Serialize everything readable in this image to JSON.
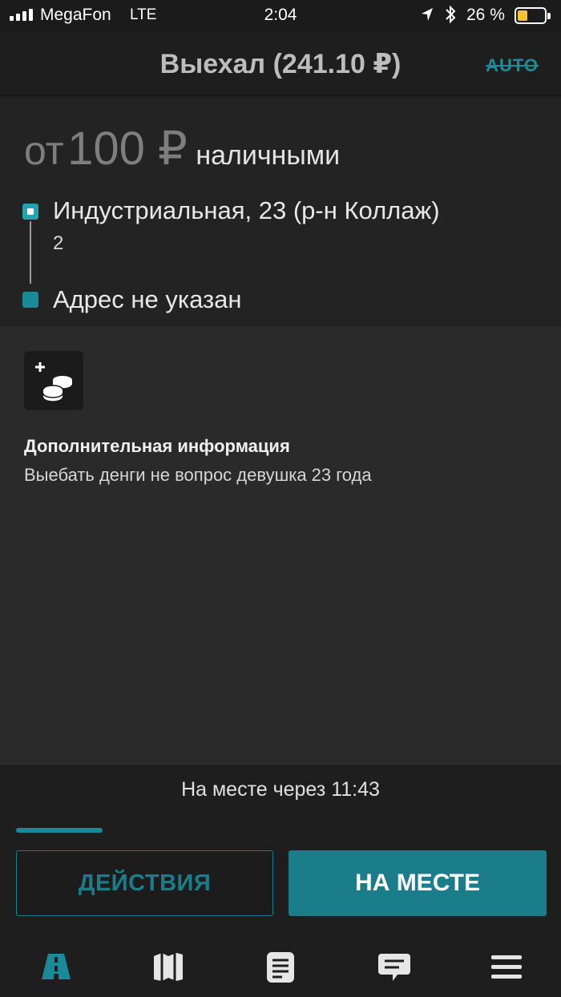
{
  "status_bar": {
    "carrier": "MegaFon",
    "network": "LTE",
    "time": "2:04",
    "battery_percent": "26 %",
    "battery_level": 0.26,
    "icons": [
      "signal-icon",
      "location-arrow-icon",
      "bluetooth-icon",
      "battery-icon"
    ]
  },
  "header": {
    "title": "Выехал (241.10 ₽)",
    "auto_label": "AUTO"
  },
  "order": {
    "price_prefix": "от",
    "price_value": "100 ₽",
    "payment": "наличными",
    "route": {
      "from_address": "Индустриальная, 23 (р-н Коллаж)",
      "from_detail": "2",
      "to_address": "Адрес не указан"
    }
  },
  "details": {
    "extra_icon": "add-coins-icon",
    "info_title": "Дополнительная информация",
    "info_text": "Выебать денги не вопрос девушка 23 года"
  },
  "bottom": {
    "eta_text": "На месте через 11:43",
    "actions_label": "ДЕЙСТВИЯ",
    "arrived_label": "НА МЕСТЕ"
  },
  "tabbar": {
    "tabs": [
      {
        "name": "road-icon",
        "active": true
      },
      {
        "name": "map-icon",
        "active": false
      },
      {
        "name": "document-icon",
        "active": false
      },
      {
        "name": "chat-icon",
        "active": false
      },
      {
        "name": "menu-icon",
        "active": false
      }
    ]
  },
  "colors": {
    "accent": "#1b7d8a",
    "accent_light": "#24a3b3",
    "background": "#1e1e1e",
    "panel": "#2a2a2a",
    "battery": "#f6c431"
  }
}
